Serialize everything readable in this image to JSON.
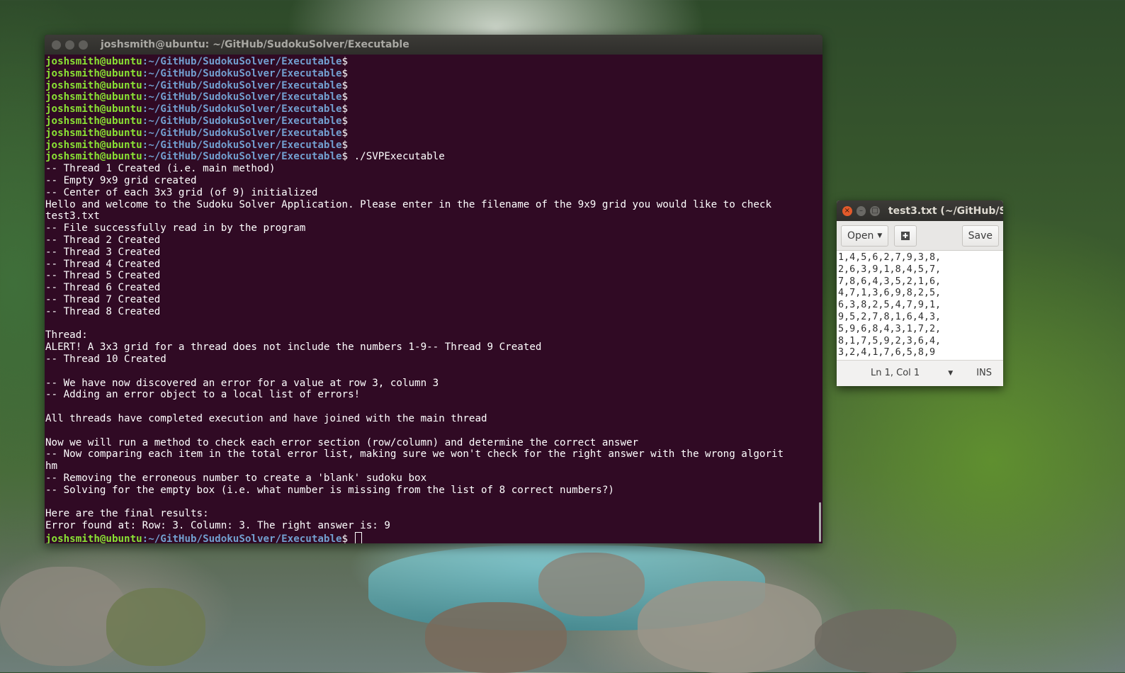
{
  "terminal": {
    "title": "joshsmith@ubuntu: ~/GitHub/SudokuSolver/Executable",
    "prompt_user": "joshsmith@ubuntu",
    "prompt_path": ":~/GitHub/SudokuSolver/Executable",
    "prompt_symbol": "$",
    "empty_prompts": 8,
    "command": " ./SVPExecutable",
    "output": [
      "-- Thread 1 Created (i.e. main method)",
      "-- Empty 9x9 grid created",
      "-- Center of each 3x3 grid (of 9) initialized",
      "Hello and welcome to the Sudoku Solver Application. Please enter in the filename of the 9x9 grid you would like to check",
      "test3.txt",
      "-- File successfully read in by the program",
      "-- Thread 2 Created",
      "-- Thread 3 Created",
      "-- Thread 4 Created",
      "-- Thread 5 Created",
      "-- Thread 6 Created",
      "-- Thread 7 Created",
      "-- Thread 8 Created",
      "",
      "Thread:",
      "ALERT! A 3x3 grid for a thread does not include the numbers 1-9-- Thread 9 Created",
      "-- Thread 10 Created",
      "",
      "-- We have now discovered an error for a value at row 3, column 3",
      "-- Adding an error object to a local list of errors!",
      "",
      "All threads have completed execution and have joined with the main thread",
      "",
      "Now we will run a method to check each error section (row/column) and determine the correct answer",
      "-- Now comparing each item in the total error list, making sure we won't check for the right answer with the wrong algorit",
      "hm",
      "-- Removing the erroneous number to create a 'blank' sudoku box",
      "-- Solving for the empty box (i.e. what number is missing from the list of 8 correct numbers?)",
      "",
      "Here are the final results:",
      "Error found at: Row: 3. Column: 3. The right answer is: 9"
    ]
  },
  "gedit": {
    "title": "test3.txt (~/GitHub/S",
    "close_glyph": "×",
    "min_glyph": "–",
    "max_glyph": "□",
    "open_label": "Open",
    "open_caret": "▼",
    "save_label": "Save",
    "content_lines": [
      "1,4,5,6,2,7,9,3,8,",
      "2,6,3,9,1,8,4,5,7,",
      "7,8,6,4,3,5,2,1,6,",
      "4,7,1,3,6,9,8,2,5,",
      "6,3,8,2,5,4,7,9,1,",
      "9,5,2,7,8,1,6,4,3,",
      "5,9,6,8,4,3,1,7,2,",
      "8,1,7,5,9,2,3,6,4,",
      "3,2,4,1,7,6,5,8,9"
    ],
    "status_position": "Ln 1, Col 1",
    "status_arrow": "▼",
    "status_mode": "INS"
  }
}
